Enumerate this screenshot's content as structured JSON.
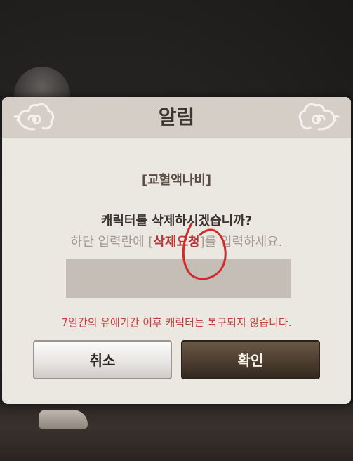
{
  "dialog": {
    "title": "알림",
    "character_name": "[교혈액나비]",
    "question": "캐릭터를 삭제하시겠습니까?",
    "instruction_prefix": "하단 입력란에 [",
    "instruction_keyword": "삭제요청",
    "instruction_suffix": "]를 입력하세요.",
    "input_value": "",
    "warning": "7일간의 유예기간 이후 캐릭터는 복구되지 않습니다.",
    "cancel_label": "취소",
    "confirm_label": "확인"
  },
  "colors": {
    "keyword": "#b33a3a",
    "warning": "#c0413a",
    "confirm_button": "#4c3d2f",
    "annotation_circle": "#d12a2a"
  },
  "icons": {
    "header_ornament": "cloud-ornament-icon",
    "annotation": "hand-drawn-circle-mark"
  }
}
